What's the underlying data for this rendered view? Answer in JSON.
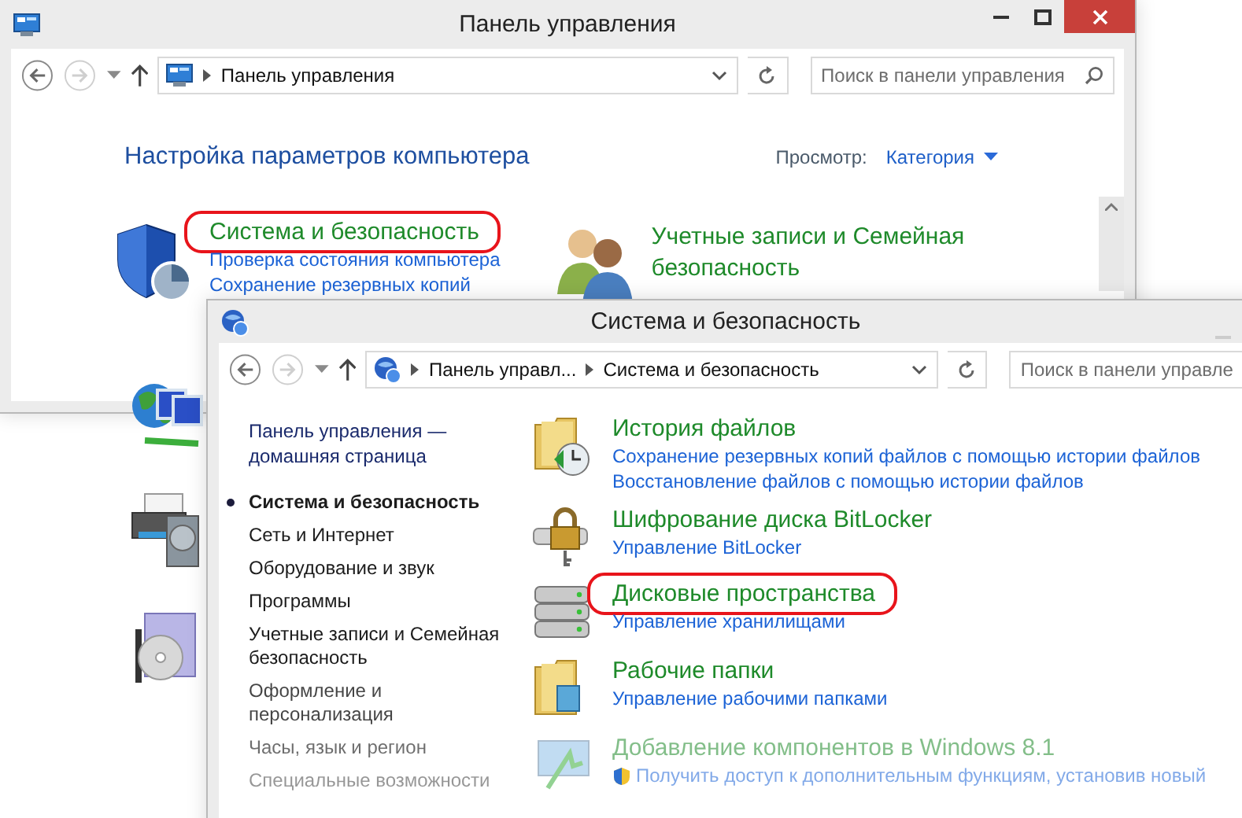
{
  "back_window": {
    "title": "Панель управления",
    "address": [
      "Панель управления"
    ],
    "search": {
      "placeholder": "Поиск в панели управления"
    },
    "heading": "Настройка параметров компьютера",
    "view_label": "Просмотр:",
    "view_value": "Категория",
    "categories": [
      {
        "title": "Система и безопасность",
        "highlighted": true,
        "links": [
          {
            "text": "Проверка состояния компьютера",
            "shield": false
          },
          {
            "text": "Сохранение резервных копий",
            "shield": false
          }
        ]
      },
      {
        "title": "Учетные записи и Семейная безопасность",
        "highlighted": false
      }
    ]
  },
  "front_window": {
    "title": "Система и безопасность",
    "address": [
      "Панель управл...",
      "Система и безопасность"
    ],
    "search": {
      "placeholder": "Поиск в панели управле"
    },
    "home_link": "Панель управления — домашняя страница",
    "nav": [
      {
        "text": "Система и безопасность",
        "selected": true
      },
      {
        "text": "Сеть и Интернет",
        "selected": false
      },
      {
        "text": "Оборудование и звук",
        "selected": false
      },
      {
        "text": "Программы",
        "selected": false
      },
      {
        "text": "Учетные записи и Семейная безопасность",
        "selected": false
      },
      {
        "text": "Оформление и персонализация",
        "selected": false
      },
      {
        "text": "Часы, язык и регион",
        "selected": false
      },
      {
        "text": "Специальные возможности",
        "selected": false
      }
    ],
    "items": [
      {
        "title": "История файлов",
        "highlighted": false,
        "links": [
          {
            "text": "Сохранение резервных копий файлов с помощью истории файлов",
            "shield": false
          },
          {
            "text": "Восстановление файлов с помощью истории файлов",
            "shield": false
          }
        ]
      },
      {
        "title": "Шифрование диска BitLocker",
        "highlighted": false,
        "links": [
          {
            "text": "Управление BitLocker",
            "shield": false
          }
        ]
      },
      {
        "title": "Дисковые пространства",
        "highlighted": true,
        "links": [
          {
            "text": "Управление хранилищами",
            "shield": false
          }
        ]
      },
      {
        "title": "Рабочие папки",
        "highlighted": false,
        "links": [
          {
            "text": "Управление рабочими папками",
            "shield": false
          }
        ]
      },
      {
        "title": "Добавление компонентов в Windows 8.1",
        "highlighted": false,
        "links": [
          {
            "text": "Получить доступ к дополнительным функциям, установив новый",
            "shield": true
          }
        ]
      }
    ]
  }
}
